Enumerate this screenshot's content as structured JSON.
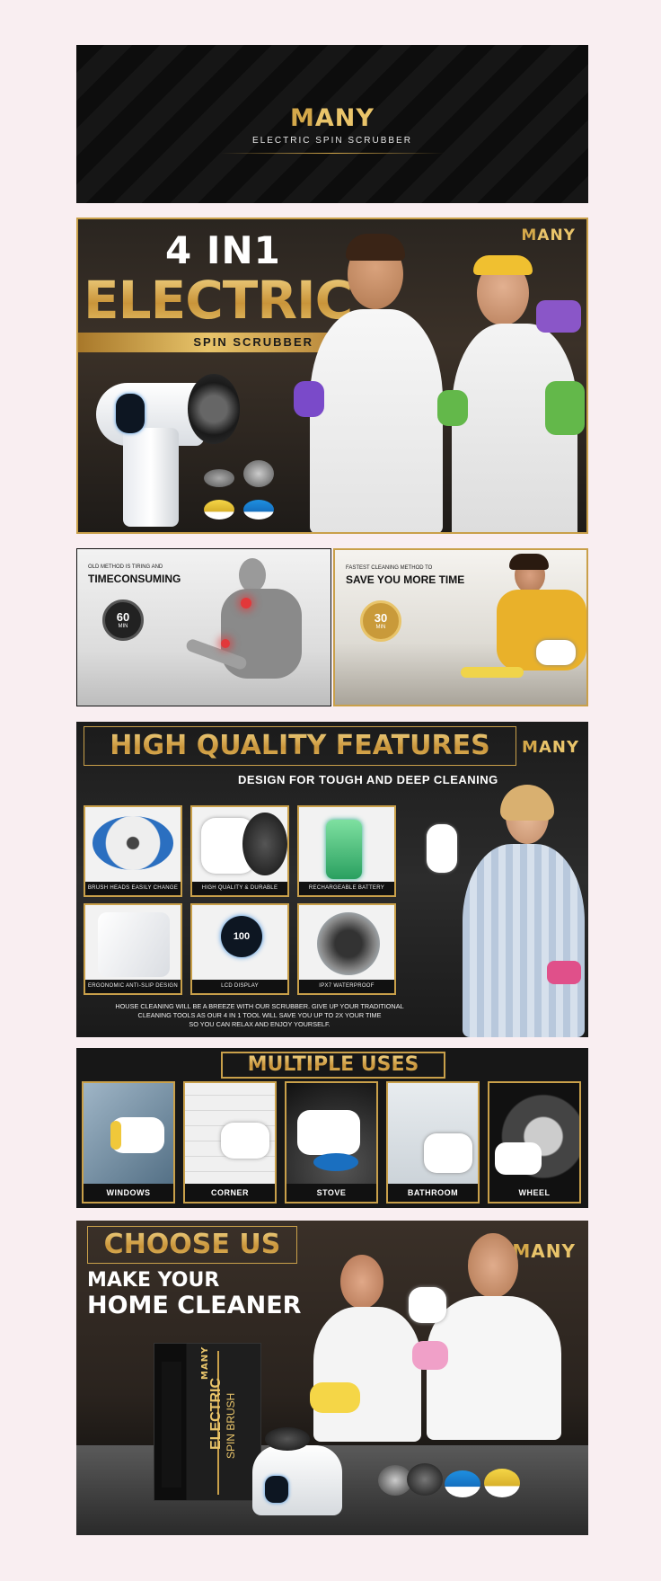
{
  "colors": {
    "gold": "#d4a84a",
    "dark": "#151515",
    "page_bg": "#f9eef1"
  },
  "logo": {
    "m": "M",
    "rest": "ANY"
  },
  "banner": {
    "subtitle": "ELECTRIC SPIN SCRUBBER"
  },
  "hero": {
    "line1": "4 IN1",
    "line2": "ELECTRIC",
    "ribbon": "SPIN SCRUBBER"
  },
  "compare": {
    "old": {
      "small": "OLD METHOD IS TIRING AND",
      "big": "TIMECONSUMING",
      "timer_value": "60",
      "timer_unit": "MIN"
    },
    "new": {
      "small": "FASTEST CLEANING METHOD TO",
      "big": "SAVE YOU MORE TIME",
      "timer_value": "30",
      "timer_unit": "MIN"
    }
  },
  "features": {
    "title": "HIGH QUALITY FEATURES",
    "subtitle": "DESIGN FOR TOUGH AND DEEP CLEANING",
    "lcd": "100",
    "items": [
      "BRUSH HEADS EASILY CHANGE",
      "HIGH QUALITY & DURABLE",
      "RECHARGEABLE BATTERY",
      "ERGONOMIC ANTI-SLIP DESIGN",
      "LCD DISPLAY",
      "IPX7 WATERPROOF"
    ],
    "desc1": "HOUSE CLEANING WILL BE A BREEZE WITH OUR SCRUBBER. GIVE UP YOUR TRADITIONAL",
    "desc2": "CLEANING TOOLS AS OUR 4 IN 1 TOOL WILL SAVE YOU UP TO 2X YOUR TIME",
    "desc3": "SO YOU CAN RELAX AND ENJOY YOURSELF."
  },
  "uses": {
    "title": "MULTIPLE USES",
    "items": [
      "WINDOWS",
      "CORNER",
      "STOVE",
      "BATHROOM",
      "WHEEL"
    ]
  },
  "choose": {
    "title": "CHOOSE US",
    "line1": "MAKE YOUR",
    "line2": "HOME CLEANER",
    "box_logo": "MANY",
    "box_line1": "ELECTRIC",
    "box_line2": "SPIN BRUSH"
  }
}
